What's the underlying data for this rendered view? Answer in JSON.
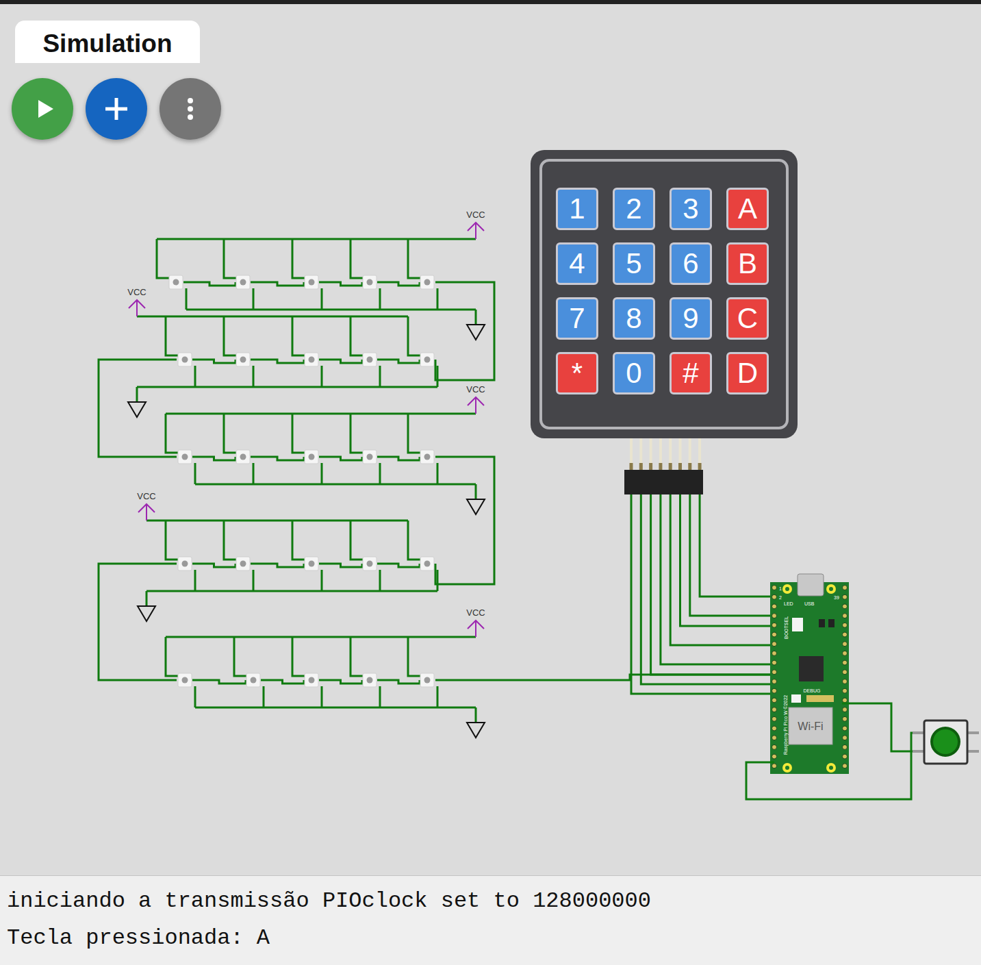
{
  "tab": {
    "label": "Simulation",
    "selected": true
  },
  "keypad": {
    "keys": [
      {
        "label": "1",
        "color": "#4a8fdc"
      },
      {
        "label": "2",
        "color": "#4a8fdc"
      },
      {
        "label": "3",
        "color": "#4a8fdc"
      },
      {
        "label": "A",
        "color": "#e8413e"
      },
      {
        "label": "4",
        "color": "#4a8fdc"
      },
      {
        "label": "5",
        "color": "#4a8fdc"
      },
      {
        "label": "6",
        "color": "#4a8fdc"
      },
      {
        "label": "B",
        "color": "#e8413e"
      },
      {
        "label": "7",
        "color": "#4a8fdc"
      },
      {
        "label": "8",
        "color": "#4a8fdc"
      },
      {
        "label": "9",
        "color": "#4a8fdc"
      },
      {
        "label": "C",
        "color": "#e8413e"
      },
      {
        "label": "*",
        "color": "#e8413e"
      },
      {
        "label": "0",
        "color": "#4a8fdc"
      },
      {
        "label": "#",
        "color": "#e8413e"
      },
      {
        "label": "D",
        "color": "#e8413e"
      }
    ]
  },
  "led_matrix": {
    "power_labels": [
      "VCC",
      "VCC",
      "VCC",
      "VCC",
      "VCC"
    ],
    "rows": [
      {
        "leds": [
          {
            "on": false
          },
          {
            "on": false
          },
          {
            "on": false
          },
          {
            "on": false
          },
          {
            "on": false
          }
        ]
      },
      {
        "leds": [
          {
            "on": false
          },
          {
            "on": false
          },
          {
            "on": false
          },
          {
            "on": false
          },
          {
            "on": false
          }
        ]
      },
      {
        "leds": [
          {
            "on": false
          },
          {
            "on": false
          },
          {
            "on": false
          },
          {
            "on": false
          },
          {
            "on": false
          }
        ]
      },
      {
        "leds": [
          {
            "on": false
          },
          {
            "on": false
          },
          {
            "on": false
          },
          {
            "on": false
          },
          {
            "on": false
          }
        ]
      },
      {
        "leds": [
          {
            "on": false
          },
          {
            "on": false
          },
          {
            "on": false
          },
          {
            "on": false
          },
          {
            "on": false
          }
        ]
      }
    ]
  },
  "board": {
    "labels": {
      "led": "LED",
      "usb": "USB",
      "bootsel": "BOOTSEL",
      "debug": "DEBUG",
      "wifi": "Wi-Fi",
      "model": "Raspberry Pi Pico W ©2022",
      "pin_1": "1",
      "pin_2": "2",
      "pin_39": "39"
    }
  },
  "pushbutton": {
    "pressed": false
  },
  "console": {
    "lines": [
      "iniciando a transmissão PIOclock set to 128000000",
      "Tecla pressionada: A"
    ]
  }
}
